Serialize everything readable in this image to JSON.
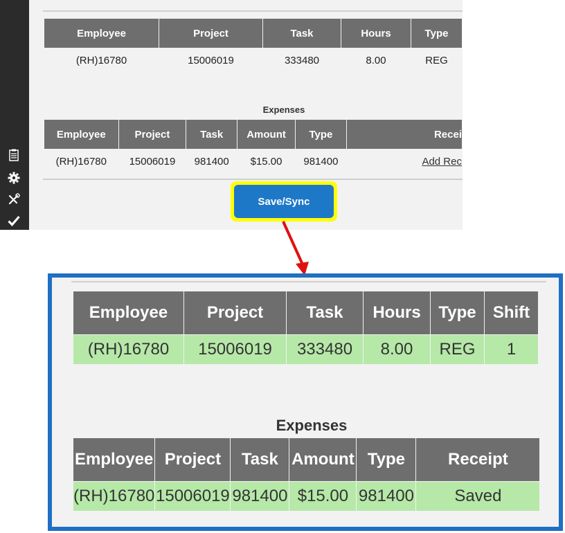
{
  "top": {
    "time_table": {
      "headers": [
        "Employee",
        "Project",
        "Task",
        "Hours",
        "Type"
      ],
      "row": [
        "(RH)16780",
        "15006019",
        "333480",
        "8.00",
        "REG"
      ]
    },
    "expenses_label": "Expenses",
    "expenses_table": {
      "headers": [
        "Employee",
        "Project",
        "Task",
        "Amount",
        "Type",
        "Recei"
      ],
      "row": [
        "(RH)16780",
        "15006019",
        "981400",
        "$15.00",
        "981400"
      ],
      "receipt_link": "Add Rec"
    },
    "save_button": "Save/Sync",
    "sidebar_icons": [
      "clipboard-icon",
      "gear-icon",
      "tools-icon",
      "checkmark-icon"
    ]
  },
  "zoom": {
    "time_table": {
      "headers": [
        "Employee",
        "Project",
        "Task",
        "Hours",
        "Type",
        "Shift"
      ],
      "row": [
        "(RH)16780",
        "15006019",
        "333480",
        "8.00",
        "REG",
        "1"
      ]
    },
    "expenses_label": "Expenses",
    "expenses_table": {
      "headers": [
        "Employee",
        "Project",
        "Task",
        "Amount",
        "Type",
        "Receipt"
      ],
      "row": [
        "(RH)16780",
        "15006019",
        "981400",
        "$15.00",
        "981400",
        "Saved"
      ]
    }
  },
  "colors": {
    "highlight": "#ffff00",
    "button": "#1e78c8",
    "zoom_border": "#1f6fc4",
    "arrow": "#e01010",
    "saved_row": "#b6e8a8",
    "header_bg": "#6e6e6e"
  }
}
